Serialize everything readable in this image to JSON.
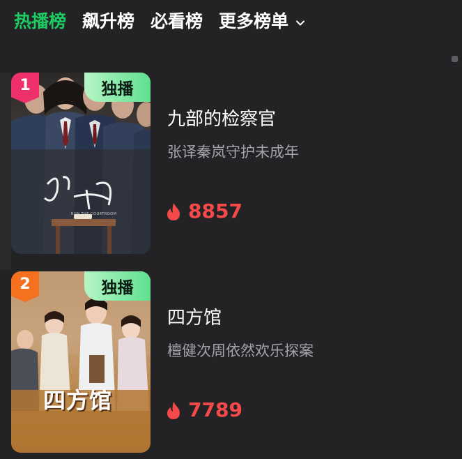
{
  "tabs": [
    {
      "label": "热播榜",
      "active": true
    },
    {
      "label": "飙升榜",
      "active": false
    },
    {
      "label": "必看榜",
      "active": false
    },
    {
      "label": "更多榜单",
      "active": false,
      "has_dropdown": true
    }
  ],
  "colors": {
    "background": "#232326",
    "active_tab": "#1ecb62",
    "rank_1": "#f0306b",
    "rank_2": "#f5701f",
    "exclusive_badge": "#5fdf8f",
    "heat": "#f64a4a",
    "subtitle": "#a4a4a8"
  },
  "items": [
    {
      "rank": "1",
      "badge": "独播",
      "title": "九部的检察官",
      "subtitle": "张译秦岚守护未成年",
      "heat": "8857",
      "heat_icon": "flame-icon",
      "poster_title_art": "九部的检察官",
      "poster_small_text": "RUN THE COURTROOM"
    },
    {
      "rank": "2",
      "badge": "独播",
      "title": "四方馆",
      "subtitle": "檀健次周依然欢乐探案",
      "heat": "7789",
      "heat_icon": "flame-icon",
      "poster_title_art": "四方馆"
    }
  ]
}
